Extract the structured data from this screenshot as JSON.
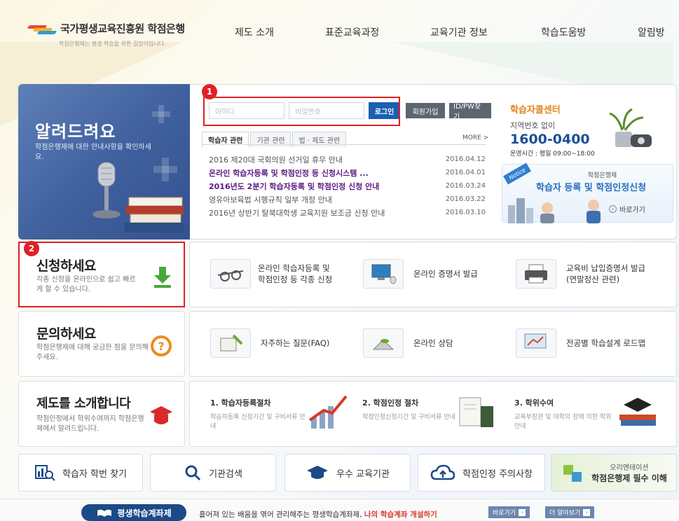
{
  "header": {
    "logo_name": "국가평생교육진흥원 학점은행",
    "logo_sub": "학점은행제는 평생 학습을 위한 길잡이입니다.",
    "nav": [
      "제도 소개",
      "표준교육과정",
      "교육기관 정보",
      "학습도움방",
      "알림방"
    ]
  },
  "notice": {
    "title": "알려드려요",
    "desc": "학점은행제에 대한 안내사항을 확인하세요.",
    "login": {
      "id_placeholder": "아이디",
      "pw_placeholder": "비밀번호",
      "login_label": "로그인",
      "join_label": "회원가입",
      "find_label": "ID/PW찾기"
    },
    "badge1": "1",
    "tabs": [
      "학습자 관련",
      "기관 관련",
      "법 · 제도 관련"
    ],
    "more": "MORE >",
    "items": [
      {
        "title": "2016 제20대 국회의원 선거일 휴무 안내",
        "date": "2016.04.12"
      },
      {
        "title": "온라인 학습자등록 및 학점인정 등 신청시스템 ...",
        "date": "2016.04.01"
      },
      {
        "title": "2016년도 2분기 학습자등록 및 학점인정 신청 안내",
        "date": "2016.03.24"
      },
      {
        "title": "영유아보육법 시행규칙 일부 개정 안내",
        "date": "2016.03.22"
      },
      {
        "title": "2016년 상반기 탈북대학생 교육지원 보조금 신청 안내",
        "date": "2016.03.10"
      }
    ],
    "call": {
      "title": "학습자콜센터",
      "sub": "지역번호 없이",
      "number": "1600-0400",
      "hours": "운영시간 : 평일 09:00~18:00"
    },
    "banner": {
      "tag": "Notice",
      "small": "학점은행제",
      "title": "학습자 등록 및 학점인정신청",
      "go": "바로가기"
    }
  },
  "apply": {
    "badge": "2",
    "title": "신청하세요",
    "desc": "각종 신청을 온라인으로 쉽고 빠르게 할 수 있습니다.",
    "items": [
      "온라인 학습자등록 및\n학점인정 등 각종 신청",
      "온라인 증명서 발급",
      "교육비 납입증명서 발급\n(연말정산 관련)"
    ]
  },
  "inquiry": {
    "title": "문의하세요",
    "desc": "학점은행제에 대해 궁금한 점을 문의해주세요.",
    "items": [
      "자주하는 질문(FAQ)",
      "온라인 상담",
      "전공별 학습설계 로드맵"
    ]
  },
  "intro": {
    "title": "제도를 소개합니다",
    "desc": "학점인정에서 학위수여까지 학점은행제에서 알려드립니다.",
    "steps": [
      {
        "title": "1. 학습자등록절차",
        "desc": "학습자등록 신청기간 및 구비서류 안내"
      },
      {
        "title": "2. 학점인정 절차",
        "desc": "학점인정신청기간 및 구비서류 안내"
      },
      {
        "title": "3. 학위수여",
        "desc": "교육부장관 및 대학의 장에 의한 학위 안내"
      }
    ]
  },
  "quick": {
    "find_num": "학습자 학번 찾기",
    "search": "기관검색",
    "excellent": "우수 교육기관",
    "caution": "학점인정 주의사항",
    "orient_small": "오리엔테이션",
    "orient_title": "학점은행제 필수 이해"
  },
  "footer": {
    "pill": "평생학습계좌제",
    "text_a": "흩어져 있는 배움을 엮어 관리해주는 평생학습계좌제, ",
    "text_b": "나의 학습계좌 개설하기",
    "btn_go": "바로가기",
    "btn_more": "더 알아보기"
  },
  "colors": {
    "accent_blue": "#1a5fb4",
    "highlight_red": "#e11f26",
    "orange": "#e2841c",
    "navy": "#1c4a86",
    "purple": "#5a1b82"
  }
}
